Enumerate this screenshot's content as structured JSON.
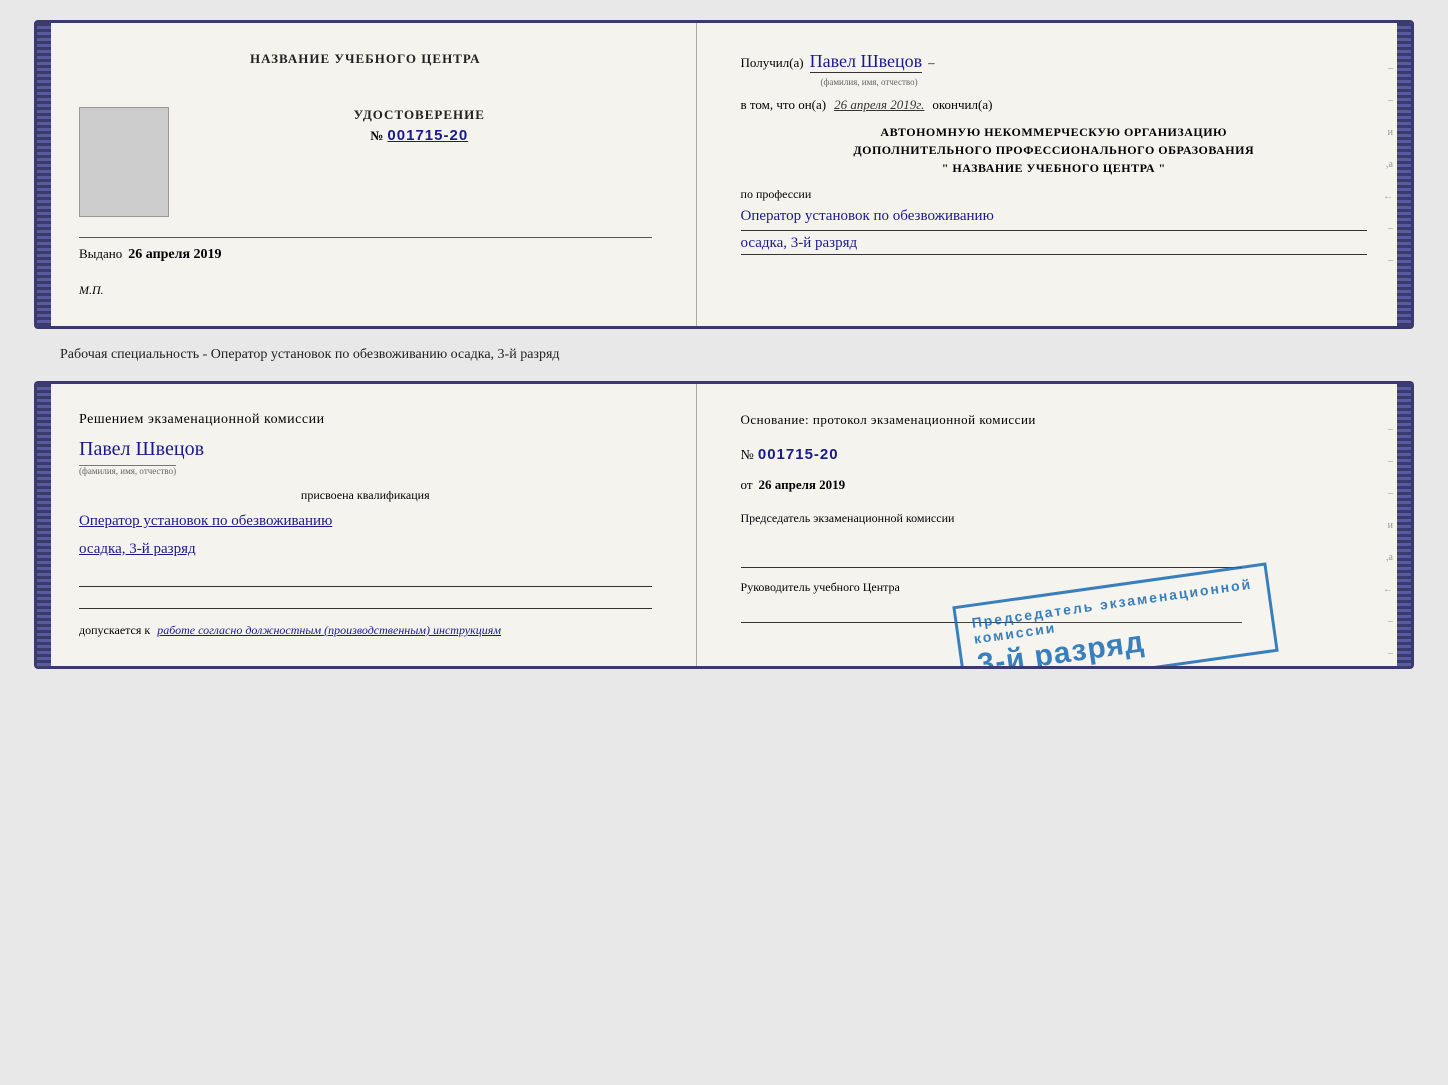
{
  "doc1": {
    "left": {
      "title": "НАЗВАНИЕ УЧЕБНОГО ЦЕНТРА",
      "cert_label": "УДОСТОВЕРЕНИЕ",
      "cert_number_prefix": "№",
      "cert_number": "001715-20",
      "issued_label": "Выдано",
      "issued_date": "26 апреля 2019",
      "mp_label": "М.П."
    },
    "right": {
      "received_prefix": "Получил(а)",
      "recipient_name": "Павел Швецов",
      "fio_label": "(фамилия, имя, отчество)",
      "dash": "–",
      "vtom_label": "в том, что он(а)",
      "completed_date": "26 апреля 2019г.",
      "completed_label": "окончил(а)",
      "org_line1": "АВТОНОМНУЮ НЕКОММЕРЧЕСКУЮ ОРГАНИЗАЦИЮ",
      "org_line2": "ДОПОЛНИТЕЛЬНОГО ПРОФЕССИОНАЛЬНОГО ОБРАЗОВАНИЯ",
      "org_line3": "\"  НАЗВАНИЕ УЧЕБНОГО ЦЕНТРА  \"",
      "profession_label": "по профессии",
      "profession_value": "Оператор установок по обезвоживанию",
      "rank_value": "осадка, 3-й разряд"
    }
  },
  "separator": {
    "text": "Рабочая специальность - Оператор установок по обезвоживанию осадка, 3-й разряд"
  },
  "doc2": {
    "left": {
      "decision_text": "Решением  экзаменационной  комиссии",
      "fio": "Павел Швецов",
      "fio_label": "(фамилия, имя, отчество)",
      "assigned_label": "присвоена квалификация",
      "qual_line1": "Оператор установок по обезвоживанию",
      "qual_line2": "осадка, 3-й разряд",
      "admission_prefix": "допускается к",
      "admission_text": "работе согласно должностным (производственным) инструкциям"
    },
    "right": {
      "basis_text": "Основание:  протокол  экзаменационной  комиссии",
      "number_prefix": "№",
      "number": "001715-20",
      "from_prefix": "от",
      "from_date": "26 апреля 2019",
      "chairman_label": "Председатель экзаменационной комиссии",
      "director_label": "Руководитель учебного Центра"
    },
    "stamp": {
      "line1": "3-й разряд"
    }
  }
}
